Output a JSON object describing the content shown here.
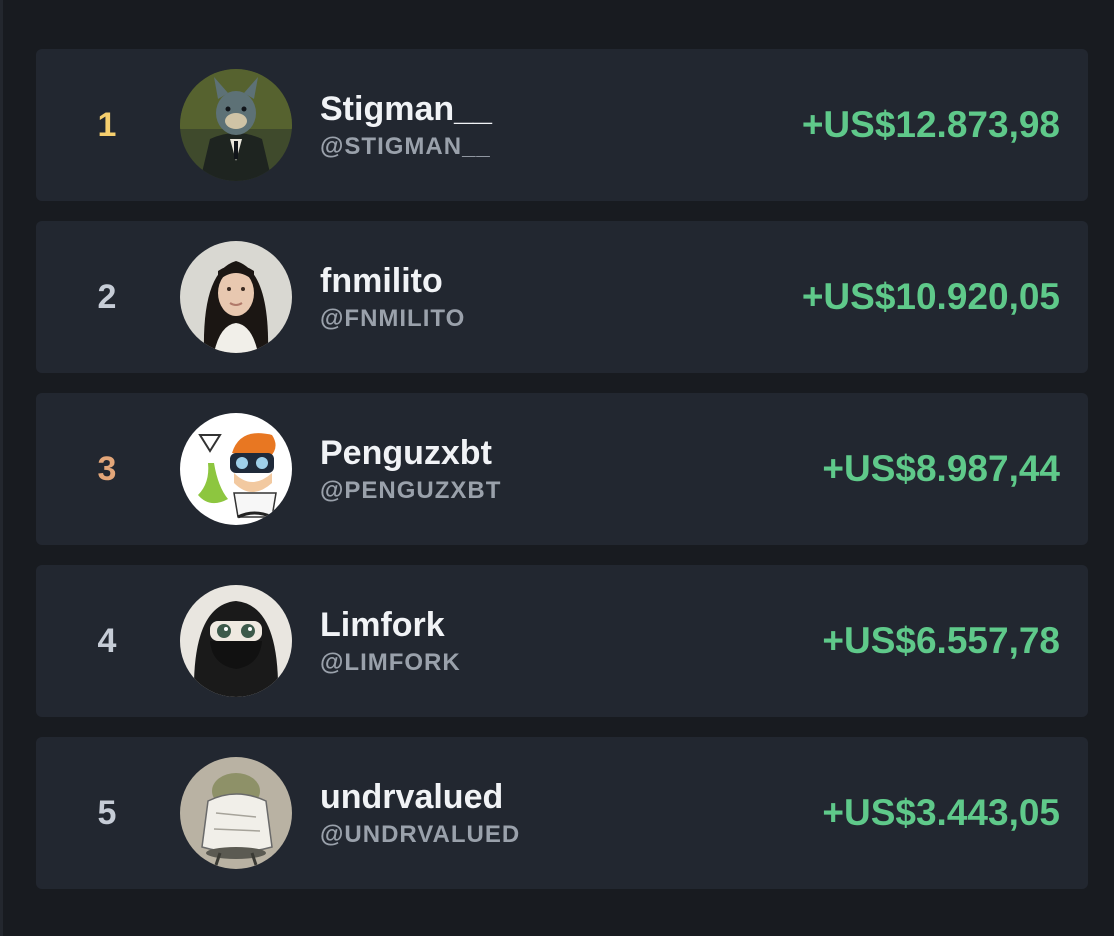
{
  "leaderboard": {
    "entries": [
      {
        "rank": "1",
        "rank_color": "#f6cf6e",
        "name": "Stigman__",
        "handle": "@STIGMAN__",
        "amount": "+US$12.873,98",
        "avatar_icon": "cat-in-suit-avatar"
      },
      {
        "rank": "2",
        "rank_color": "#c6ccd6",
        "name": "fnmilito",
        "handle": "@FNMILITO",
        "amount": "+US$10.920,05",
        "avatar_icon": "woman-portrait-avatar"
      },
      {
        "rank": "3",
        "rank_color": "#e3a679",
        "name": "Penguzxbt",
        "handle": "@PENGUZXBT",
        "amount": "+US$8.987,44",
        "avatar_icon": "cartoon-scientist-avatar"
      },
      {
        "rank": "4",
        "rank_color": "#c6ccd6",
        "name": "Limfork",
        "handle": "@LIMFORK",
        "amount": "+US$6.557,78",
        "avatar_icon": "veiled-character-avatar"
      },
      {
        "rank": "5",
        "rank_color": "#c6ccd6",
        "name": "undrvalued",
        "handle": "@UNDRVALUED",
        "amount": "+US$3.443,05",
        "avatar_icon": "cloaked-bird-avatar"
      }
    ]
  },
  "colors": {
    "background": "#181b20",
    "row_background": "#222730",
    "amount_positive": "#5fc98a"
  }
}
